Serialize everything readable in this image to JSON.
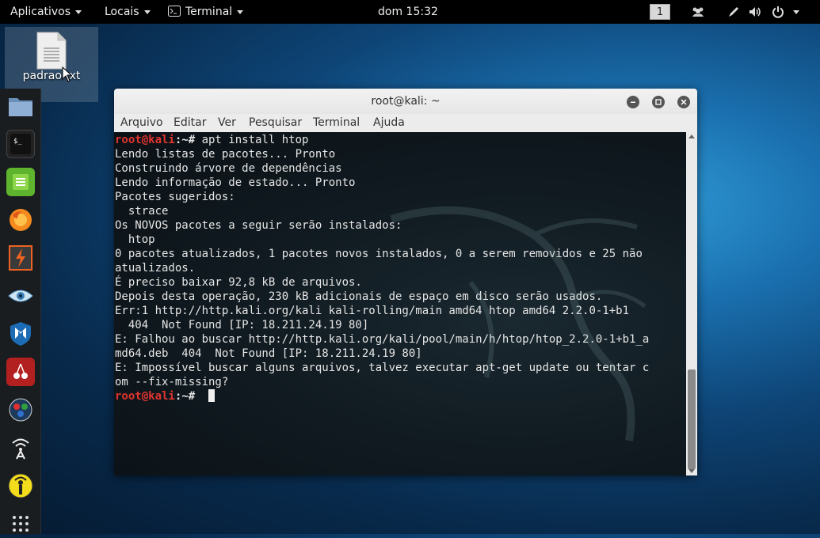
{
  "topbar": {
    "apps_label": "Aplicativos",
    "places_label": "Locais",
    "terminal_label": "Terminal",
    "clock": "dom 15:32",
    "workspace": "1"
  },
  "desktop": {
    "file_label": "padrao.txt"
  },
  "dock": {
    "items": [
      "files-icon",
      "terminal-icon",
      "text-editor-icon",
      "firefox-icon",
      "burpsuite-icon",
      "eye-icon",
      "metasploit-icon",
      "cherrytree-icon",
      "maltego-icon",
      "wireless-icon",
      "beef-icon",
      "show-apps-icon"
    ]
  },
  "window": {
    "title": "root@kali: ~",
    "menu": [
      "Arquivo",
      "Editar",
      "Ver",
      "Pesquisar",
      "Terminal",
      "Ajuda"
    ]
  },
  "terminal": {
    "prompt_user": "root@kali",
    "prompt_path": ":~# ",
    "command": "apt install htop",
    "output": [
      "Lendo listas de pacotes... Pronto",
      "Construindo árvore de dependências",
      "Lendo informação de estado... Pronto",
      "Pacotes sugeridos:",
      "  strace",
      "Os NOVOS pacotes a seguir serão instalados:",
      "  htop",
      "0 pacotes atualizados, 1 pacotes novos instalados, 0 a serem removidos e 25 não",
      "atualizados.",
      "É preciso baixar 92,8 kB de arquivos.",
      "Depois desta operação, 230 kB adicionais de espaço em disco serão usados.",
      "Err:1 http://http.kali.org/kali kali-rolling/main amd64 htop amd64 2.2.0-1+b1",
      "  404  Not Found [IP: 18.211.24.19 80]",
      "E: Falhou ao buscar http://http.kali.org/kali/pool/main/h/htop/htop_2.2.0-1+b1_a",
      "md64.deb  404  Not Found [IP: 18.211.24.19 80]",
      "E: Impossível buscar alguns arquivos, talvez executar apt-get update ou tentar c",
      "om --fix-missing?"
    ]
  }
}
